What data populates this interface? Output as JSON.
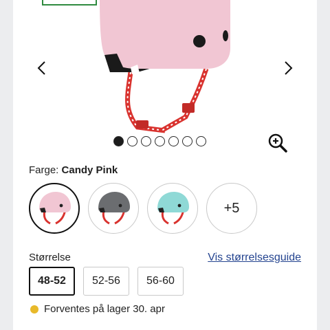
{
  "gallery": {
    "prev_icon": "chevron-left-icon",
    "next_icon": "chevron-right-icon",
    "zoom_icon": "zoom-in-icon",
    "dots_total": 7,
    "active_dot": 1
  },
  "color": {
    "label": "Farge:",
    "selected_name": "Candy Pink",
    "swatches": [
      {
        "name": "Candy Pink",
        "color": "#f1c6d3",
        "selected": true
      },
      {
        "name": "Grey",
        "color": "#6b6d70",
        "selected": false
      },
      {
        "name": "Mint",
        "color": "#8fd9d6",
        "selected": false
      }
    ],
    "more_label": "+5"
  },
  "size": {
    "label": "Størrelse",
    "guide_link": "Vis størrelsesguide",
    "options": [
      "48-52",
      "52-56",
      "56-60"
    ],
    "selected": "48-52"
  },
  "stock": {
    "text": "Forventes på lager 30. apr",
    "status_color": "#e8b92a"
  },
  "colors": {
    "helmet_pink": "#f1c6d3",
    "strap_red": "#d9332f",
    "link_blue": "#23438f"
  }
}
